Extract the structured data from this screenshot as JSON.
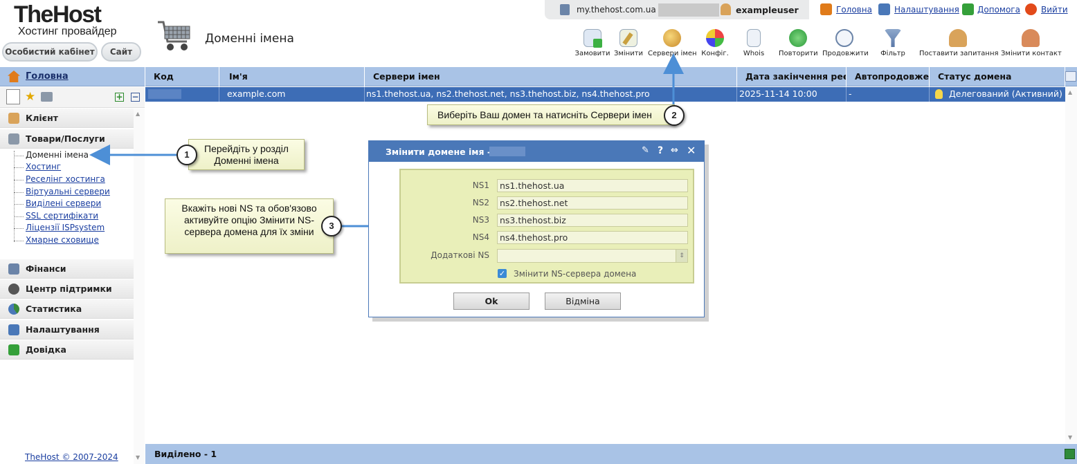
{
  "brand": {
    "logo_line1": "TheHost",
    "logo_line2": "Хостинг провайдер",
    "btn_cabinet": "Особистий кабінет",
    "btn_site": "Сайт"
  },
  "page_title": "Доменні імена",
  "topbar": {
    "host": "my.thehost.com.ua ::",
    "username": "exampleuser"
  },
  "topnav": [
    {
      "label": "Головна",
      "icon": "home-icon",
      "color": "#e07b1a"
    },
    {
      "label": "Налаштування",
      "icon": "settings-icon",
      "color": "#4a78b8"
    },
    {
      "label": "Допомога",
      "icon": "help-icon",
      "color": "#35a03a"
    },
    {
      "label": "Вийти",
      "icon": "power-icon",
      "color": "#e24a1a"
    }
  ],
  "toolbar": [
    {
      "label": "Замовити",
      "icon": "order-icon"
    },
    {
      "label": "Змінити",
      "icon": "edit-icon"
    },
    {
      "label": "Сервери імен",
      "icon": "nameservers-icon"
    },
    {
      "label": "Конфіг.",
      "icon": "config-icon"
    },
    {
      "label": "Whois",
      "icon": "whois-icon"
    },
    {
      "label": "Повторити",
      "icon": "repeat-icon"
    },
    {
      "label": "Продовжити",
      "icon": "renew-icon"
    },
    {
      "label": "Фільтр",
      "icon": "filter-icon"
    },
    {
      "label": "Поставити запитання",
      "icon": "ask-question-icon"
    },
    {
      "label": "Змінити контакт",
      "icon": "change-contact-icon"
    }
  ],
  "sidebar": {
    "main": "Головна",
    "sections": [
      {
        "label": "Клієнт",
        "icon": "client-icon"
      },
      {
        "label": "Товари/Послуги",
        "icon": "cart-icon"
      }
    ],
    "items": [
      "Доменні імена",
      "Хостинг",
      "Реселінг хостинга",
      "Віртуальні сервери",
      "Виділені сервери",
      "SSL сертифікати",
      "Ліцензії ISPsystem",
      "Хмарне сховище"
    ],
    "sections2": [
      {
        "label": "Фінанси",
        "icon": "finance-icon"
      },
      {
        "label": "Центр підтримки",
        "icon": "support-icon"
      },
      {
        "label": "Статистика",
        "icon": "stats-icon"
      },
      {
        "label": "Налаштування",
        "icon": "settings-icon"
      },
      {
        "label": "Довідка",
        "icon": "help-icon"
      }
    ],
    "copyright": "TheHost © 2007-2024"
  },
  "table": {
    "headers": [
      "Код",
      "Ім'я",
      "Сервери імен",
      "Дата закінчення реєст",
      "Автопродовжені",
      "Статус домена"
    ],
    "row": {
      "code": "",
      "name": "example.com",
      "ns": "ns1.thehost.ua, ns2.thehost.net, ns3.thehost.biz, ns4.thehost.pro",
      "expires": "2025-11-14 10:00",
      "autorenew": "-",
      "status": "Делегований (Активний)"
    },
    "footer": "Виділено - 1"
  },
  "callouts": [
    {
      "n": "1",
      "text": "Перейдіть у розділ Доменні імена"
    },
    {
      "n": "2",
      "text": "Виберіть Ваш домен та натисніть Сервери імен"
    },
    {
      "n": "3",
      "text": "Вкажіть нові NS та обов'язово активуйте опцію Змінити NS-сервера домена для їх зміни"
    }
  ],
  "dialog": {
    "title": "Змінити домене імя -",
    "fields": [
      {
        "label": "NS1",
        "value": "ns1.thehost.ua"
      },
      {
        "label": "NS2",
        "value": "ns2.thehost.net"
      },
      {
        "label": "NS3",
        "value": "ns3.thehost.biz"
      },
      {
        "label": "NS4",
        "value": "ns4.thehost.pro"
      },
      {
        "label": "Додаткові NS",
        "value": ""
      }
    ],
    "checkbox_label": "Змінити NS-сервера домена",
    "ok": "Ok",
    "cancel": "Відміна"
  },
  "colors": {
    "accent": "#4a78b8",
    "header_bg": "#a9c3e6",
    "selected_row": "#3d6db6",
    "callout_bg": "#f4f6d6"
  }
}
